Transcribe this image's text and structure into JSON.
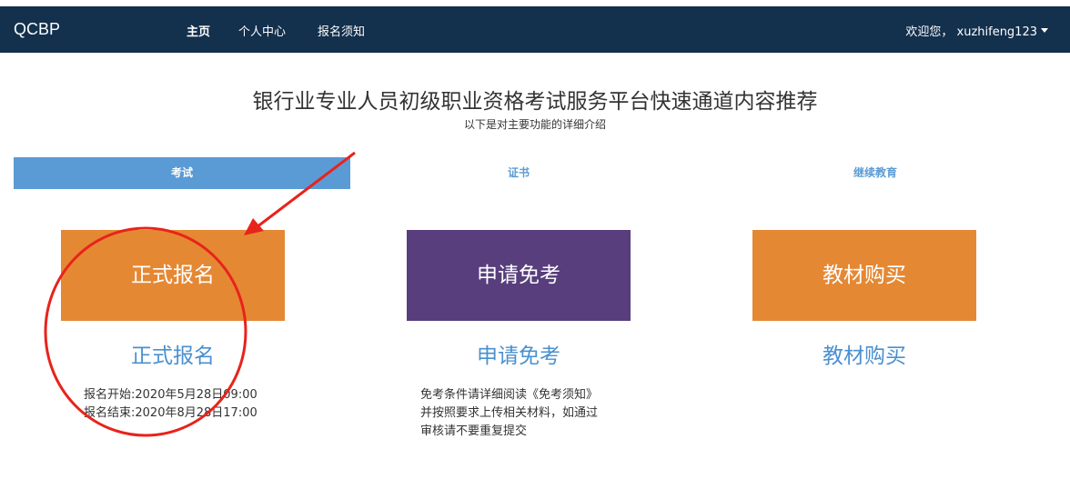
{
  "navbar": {
    "brand": "QCBP",
    "links": [
      "主页",
      "个人中心",
      "报名须知"
    ],
    "user": "欢迎您， xuzhifeng123"
  },
  "header": {
    "title": "银行业专业人员初级职业资格考试服务平台快速通道内容推荐",
    "subtitle": "以下是对主要功能的详细介绍"
  },
  "tabs": [
    "考试",
    "证书",
    "继续教育"
  ],
  "cards": [
    {
      "tile": "正式报名",
      "link": "正式报名",
      "color": "#e58833",
      "desc": [
        "报名开始:2020年5月28日09:00",
        "报名结束:2020年8月28日17:00"
      ]
    },
    {
      "tile": "申请免考",
      "link": "申请免考",
      "color": "#583e7c",
      "desc": [
        "免考条件请详细阅读《免考须知》",
        "并按照要求上传相关材料，如通过",
        "审核请不要重复提交"
      ]
    },
    {
      "tile": "教材购买",
      "link": "教材购买",
      "color": "#e58833",
      "desc": []
    }
  ],
  "colors": {
    "navbar": "#13304d",
    "accent": "#5b9bd5",
    "annotation": "#e8231b"
  }
}
